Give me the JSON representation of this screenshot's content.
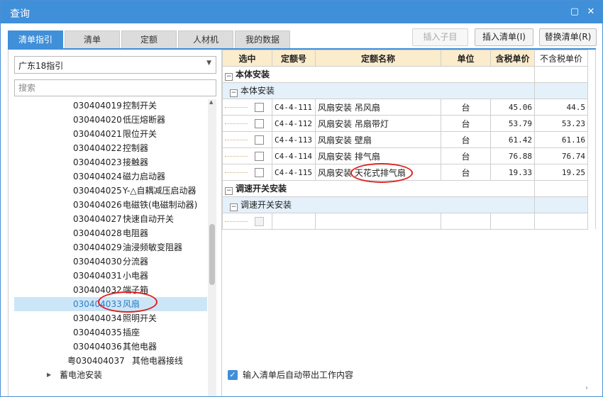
{
  "window": {
    "title": "查询",
    "restore_glyph": "▢",
    "close_glyph": "✕"
  },
  "tabs": [
    "清单指引",
    "清单",
    "定额",
    "人材机",
    "我的数据"
  ],
  "toolbar": {
    "insert_child": "插入子目",
    "insert_list": "插入清单(I)",
    "replace_list": "替换清单(R)"
  },
  "left": {
    "region_select": "广东18指引",
    "search_placeholder": "搜索",
    "tree_items": [
      {
        "code": "030404019",
        "name": "控制开关"
      },
      {
        "code": "030404020",
        "name": "低压熔断器"
      },
      {
        "code": "030404021",
        "name": "限位开关"
      },
      {
        "code": "030404022",
        "name": "控制器"
      },
      {
        "code": "030404023",
        "name": "接触器"
      },
      {
        "code": "030404024",
        "name": "磁力启动器"
      },
      {
        "code": "030404025",
        "name": "Y-△自耦减压启动器"
      },
      {
        "code": "030404026",
        "name": "电磁铁(电磁制动器)"
      },
      {
        "code": "030404027",
        "name": "快速自动开关"
      },
      {
        "code": "030404028",
        "name": "电阻器"
      },
      {
        "code": "030404029",
        "name": "油浸频敏变阻器"
      },
      {
        "code": "030404030",
        "name": "分流器"
      },
      {
        "code": "030404031",
        "name": "小电器"
      },
      {
        "code": "030404032",
        "name": "端子箱"
      },
      {
        "code": "030404033",
        "name": "风扇"
      },
      {
        "code": "030404034",
        "name": "照明开关"
      },
      {
        "code": "030404035",
        "name": "插座"
      },
      {
        "code": "030404036",
        "name": "其他电器"
      },
      {
        "code": "粤030404037",
        "name": "其他电器接线"
      }
    ],
    "group_item": "蓄电池安装"
  },
  "grid": {
    "headers": [
      "选中",
      "定额号",
      "定额名称",
      "单位",
      "含税单价",
      "不含税单价"
    ],
    "group1": "本体安装",
    "group1_sub": "本体安装",
    "rows": [
      {
        "code": "C4-4-111",
        "name": "风扇安装 吊风扇",
        "unit": "台",
        "price_tax": "45.06",
        "price_notax": "44.5"
      },
      {
        "code": "C4-4-112",
        "name": "风扇安装 吊扇带灯",
        "unit": "台",
        "price_tax": "53.79",
        "price_notax": "53.23"
      },
      {
        "code": "C4-4-113",
        "name": "风扇安装 壁扇",
        "unit": "台",
        "price_tax": "61.42",
        "price_notax": "61.16"
      },
      {
        "code": "C4-4-114",
        "name": "风扇安装 排气扇",
        "unit": "台",
        "price_tax": "76.88",
        "price_notax": "76.74"
      },
      {
        "code": "C4-4-115",
        "name": "风扇安装 天花式排气扇",
        "unit": "台",
        "price_tax": "19.33",
        "price_notax": "19.25"
      }
    ],
    "group2": "调速开关安装",
    "group2_sub": "调速开关安装",
    "expand_glyph": "−"
  },
  "options": {
    "auto_fill_label": "输入清单后自动带出工作内容",
    "check_glyph": "✓"
  },
  "glyphs": {
    "dropdown": "▼",
    "caret_right": "▶",
    "scroll_up": "▲",
    "scroll_right": "›"
  },
  "colors": {
    "accent": "#3f8fd9",
    "header_bg": "#fbeccc",
    "selected_row": "#cde6f7",
    "annotation": "#e02020"
  }
}
